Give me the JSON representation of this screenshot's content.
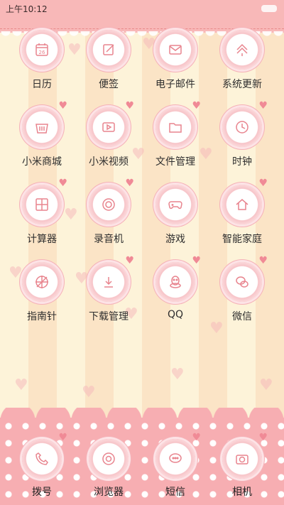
{
  "status_bar": {
    "time": "上午10:12"
  },
  "apps": [
    {
      "label": "日历",
      "icon": "calendar-icon",
      "badge": "26"
    },
    {
      "label": "便签",
      "icon": "note-icon"
    },
    {
      "label": "电子邮件",
      "icon": "mail-icon"
    },
    {
      "label": "系统更新",
      "icon": "update-icon"
    },
    {
      "label": "小米商城",
      "icon": "shop-basket-icon"
    },
    {
      "label": "小米视频",
      "icon": "video-icon"
    },
    {
      "label": "文件管理",
      "icon": "folder-icon"
    },
    {
      "label": "时钟",
      "icon": "clock-icon"
    },
    {
      "label": "计算器",
      "icon": "calculator-icon"
    },
    {
      "label": "录音机",
      "icon": "recorder-icon"
    },
    {
      "label": "游戏",
      "icon": "gamepad-icon"
    },
    {
      "label": "智能家庭",
      "icon": "home-icon"
    },
    {
      "label": "指南针",
      "icon": "compass-icon"
    },
    {
      "label": "下载管理",
      "icon": "download-icon"
    },
    {
      "label": "QQ",
      "icon": "qq-penguin-icon"
    },
    {
      "label": "微信",
      "icon": "wechat-icon"
    }
  ],
  "dock": [
    {
      "label": "拨号",
      "icon": "phone-icon"
    },
    {
      "label": "浏览器",
      "icon": "browser-icon"
    },
    {
      "label": "短信",
      "icon": "message-icon"
    },
    {
      "label": "相机",
      "icon": "camera-icon"
    }
  ],
  "pager": {
    "pages": 3,
    "active": 2
  },
  "colors": {
    "accent": "#f8b8b8",
    "icon_stroke": "#e8848e",
    "label": "#2e2e2e"
  }
}
